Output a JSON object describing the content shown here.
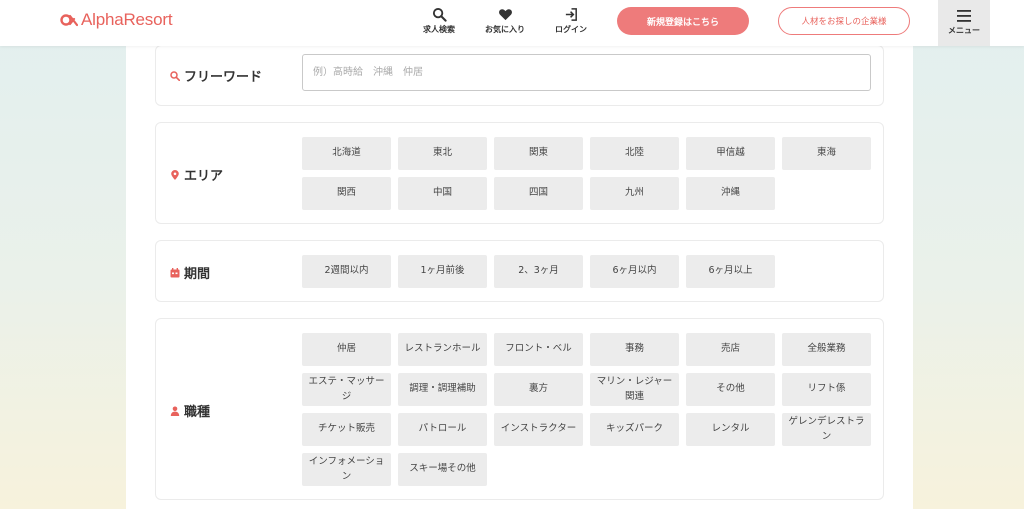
{
  "brand": {
    "name": "AlphaResort",
    "accent": "#e8625c"
  },
  "header": {
    "nav": [
      {
        "label": "求人検索",
        "icon": "search-icon"
      },
      {
        "label": "お気に入り",
        "icon": "heart-icon"
      },
      {
        "label": "ログイン",
        "icon": "login-icon"
      }
    ],
    "register_label": "新規登録はこちら",
    "company_label": "人材をお探しの企業様",
    "menu_label": "メニュー"
  },
  "freeword": {
    "label": "フリーワード",
    "placeholder": "例）高時給　沖縄　仲居"
  },
  "area": {
    "label": "エリア",
    "options": [
      "北海道",
      "東北",
      "関東",
      "北陸",
      "甲信越",
      "東海",
      "関西",
      "中国",
      "四国",
      "九州",
      "沖縄"
    ]
  },
  "period": {
    "label": "期間",
    "options": [
      "2週間以内",
      "1ヶ月前後",
      "2、3ヶ月",
      "6ヶ月以内",
      "6ヶ月以上"
    ]
  },
  "job": {
    "label": "職種",
    "options": [
      "仲居",
      "レストランホール",
      "フロント・ベル",
      "事務",
      "売店",
      "全般業務",
      "エステ・マッサージ",
      "調理・調理補助",
      "裏方",
      "マリン・レジャー関連",
      "その他",
      "リフト係",
      "チケット販売",
      "パトロール",
      "インストラクター",
      "キッズパーク",
      "レンタル",
      "ゲレンデレストラン",
      "インフォメーション",
      "スキー場その他"
    ]
  }
}
